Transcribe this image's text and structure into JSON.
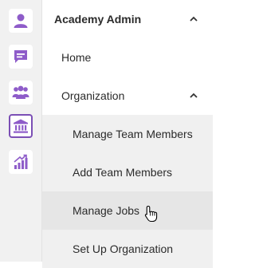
{
  "rail": {
    "items": [
      {
        "icon": "user-icon",
        "active": false
      },
      {
        "icon": "chat-icon",
        "active": false
      },
      {
        "icon": "team-icon",
        "active": false
      },
      {
        "icon": "institution-icon",
        "active": true
      },
      {
        "icon": "chart-growth-icon",
        "active": false
      }
    ],
    "accent_color": "#7b4fb5"
  },
  "menu": {
    "section_title": "Academy Admin",
    "home_label": "Home",
    "organization_label": "Organization",
    "organization_items": [
      {
        "label": "Manage Team Members"
      },
      {
        "label": "Add Team Members"
      },
      {
        "label": "Manage Jobs"
      },
      {
        "label": "Set Up Organization"
      }
    ]
  }
}
